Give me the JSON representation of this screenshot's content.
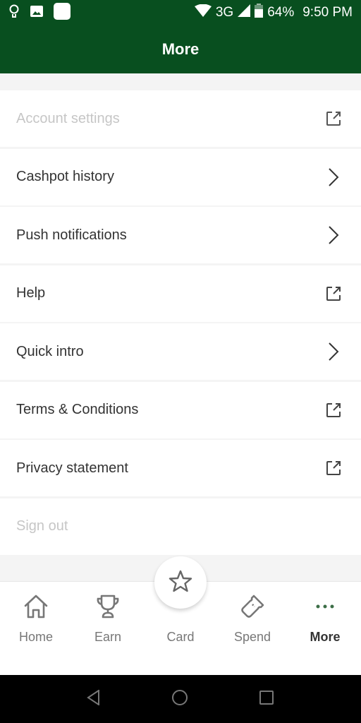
{
  "status_bar": {
    "network": "3G",
    "battery": "64%",
    "time": "9:50 PM",
    "icons": [
      "lightbulb-icon",
      "image-icon",
      "app-icon",
      "wifi-icon",
      "signal-icon",
      "battery-icon"
    ]
  },
  "header": {
    "title": "More"
  },
  "menu": {
    "items": [
      {
        "label": "Account settings",
        "icon": "external-link-icon",
        "disabled": true
      },
      {
        "label": "Cashpot history",
        "icon": "chevron-right-icon",
        "disabled": false
      },
      {
        "label": "Push notifications",
        "icon": "chevron-right-icon",
        "disabled": false
      },
      {
        "label": "Help",
        "icon": "external-link-icon",
        "disabled": false
      },
      {
        "label": "Quick intro",
        "icon": "chevron-right-icon",
        "disabled": false
      },
      {
        "label": "Terms & Conditions",
        "icon": "external-link-icon",
        "disabled": false
      },
      {
        "label": "Privacy statement",
        "icon": "external-link-icon",
        "disabled": false
      },
      {
        "label": "Sign out",
        "icon": "",
        "disabled": true
      }
    ]
  },
  "tab_bar": {
    "tabs": [
      {
        "label": "Home",
        "icon": "home-icon"
      },
      {
        "label": "Earn",
        "icon": "trophy-icon"
      },
      {
        "label": "Card",
        "icon": "star-icon"
      },
      {
        "label": "Spend",
        "icon": "ticket-icon"
      },
      {
        "label": "More",
        "icon": "more-dots-icon",
        "active": true
      }
    ]
  },
  "colors": {
    "brand": "#084f1f",
    "accent_dots": "#3c6e47"
  }
}
